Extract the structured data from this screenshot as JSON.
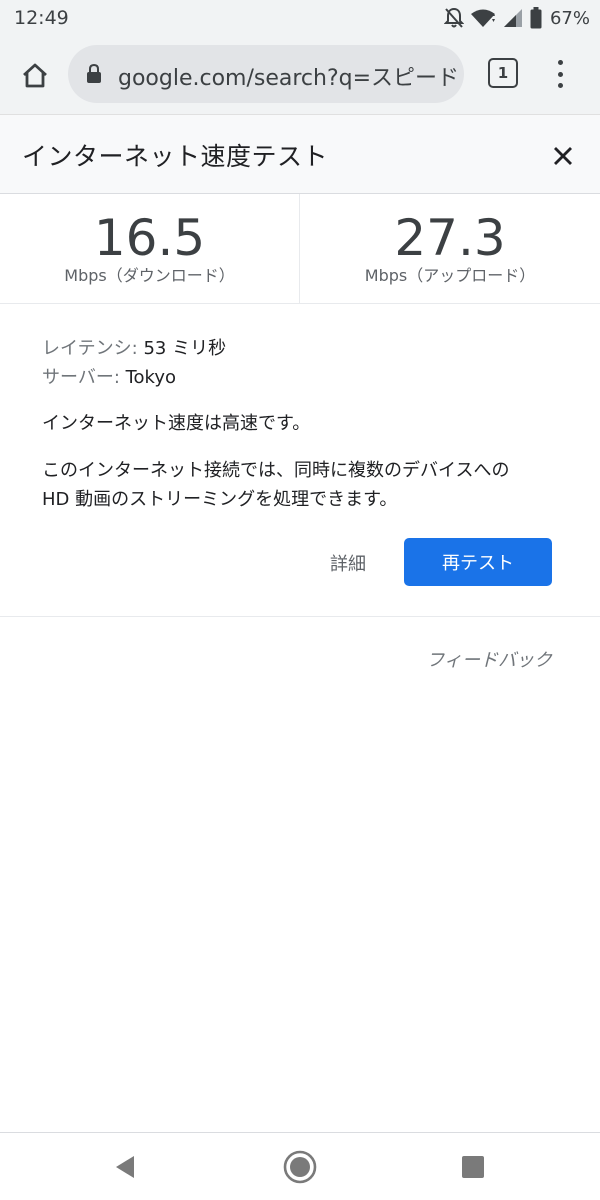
{
  "status_bar": {
    "time": "12:49",
    "battery": "67%",
    "icons": [
      "notifications-off-icon",
      "wifi-icon",
      "signal-icon",
      "battery-icon"
    ]
  },
  "browser": {
    "url": "google.com/search?q=スピード",
    "tab_count": "1",
    "icons": [
      "home-icon",
      "lock-icon",
      "tabs-icon",
      "menu-icon"
    ]
  },
  "panel": {
    "title": "インターネット速度テスト",
    "download": {
      "value": "16.5",
      "label": "Mbps（ダウンロード）"
    },
    "upload": {
      "value": "27.3",
      "label": "Mbps（アップロード）"
    },
    "latency_key": "レイテンシ:",
    "latency_value": " 53 ミリ秒",
    "server_key": "サーバー:",
    "server_value": " Tokyo",
    "summary": "インターネット速度は高速です。",
    "description_line1": "このインターネット接続では、同時に複数のデバイスへの",
    "description_line2": "HD 動画のストリーミングを処理できます。",
    "details_label": "詳細",
    "retest_label": "再テスト",
    "feedback_label": "フィードバック"
  },
  "colors": {
    "accent": "#1a73e8",
    "toolbar_bg": "#f1f3f4",
    "omnibox_bg": "#e2e4e7"
  }
}
